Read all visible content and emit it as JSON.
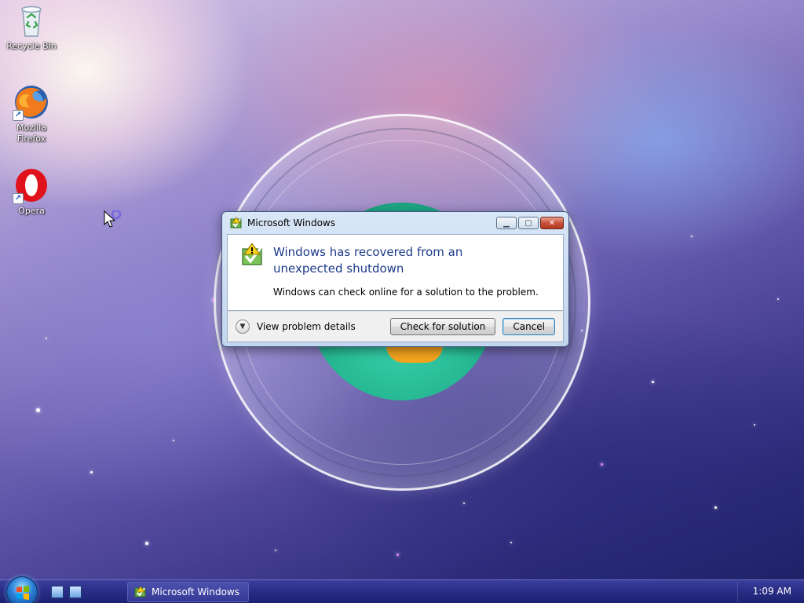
{
  "desktop": {
    "icons": [
      {
        "label": "Recycle Bin"
      },
      {
        "label": "Mozilla Firefox"
      },
      {
        "label": "Opera"
      }
    ]
  },
  "dialog": {
    "title": "Microsoft Windows",
    "headline": "Windows has recovered from an unexpected shutdown",
    "message": "Windows can check online for a solution to the problem.",
    "details_label": "View problem details",
    "primary_button": "Check for solution",
    "cancel_button": "Cancel"
  },
  "taskbar": {
    "task_title": "Microsoft Windows",
    "clock": "1:09 AM"
  },
  "colors": {
    "headline": "#1e3b8a",
    "taskbar": "#2a2e86",
    "close_button": "#c84c34"
  },
  "icons": [
    "recycle-bin-icon",
    "firefox-icon",
    "opera-icon",
    "shortcut-arrow-icon",
    "shield-warning-icon",
    "chevron-down-icon",
    "minimize-icon",
    "maximize-icon",
    "close-icon",
    "windows-logo-icon",
    "show-desktop-icon",
    "switch-windows-icon",
    "mouse-pointer-icon"
  ]
}
